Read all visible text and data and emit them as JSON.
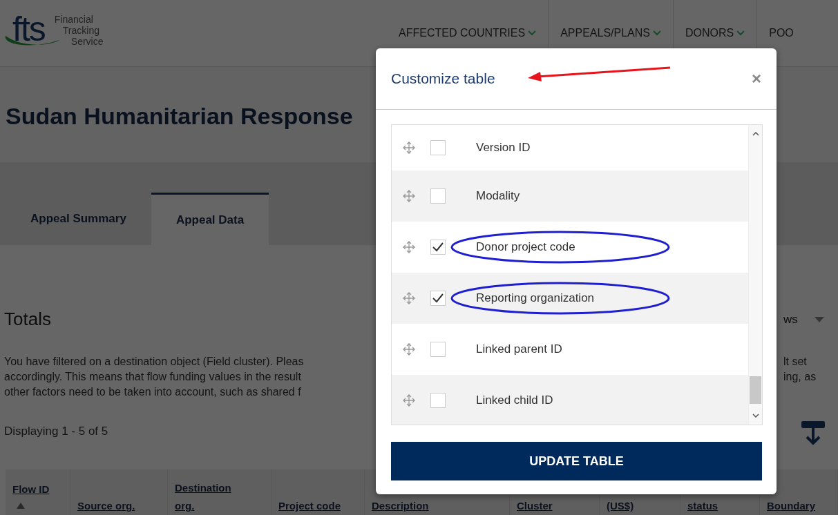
{
  "header": {
    "logo": {
      "mark": "fts",
      "lines": [
        "Financial",
        "Tracking",
        "Service"
      ]
    },
    "nav": [
      {
        "label": "AFFECTED COUNTRIES",
        "dropdown": true
      },
      {
        "label": "APPEALS/PLANS",
        "dropdown": true
      },
      {
        "label": "DONORS",
        "dropdown": true
      },
      {
        "label": "POO",
        "dropdown": false
      }
    ]
  },
  "page_title": "Sudan Humanitarian Response",
  "tabs": [
    {
      "label": "Appeal Summary",
      "selected": false
    },
    {
      "label": "Appeal Data",
      "selected": true
    }
  ],
  "totals": {
    "heading": "Totals",
    "rows_control": "ws",
    "paragraph_lines": [
      "You have filtered on a destination object (Field cluster). Pleas",
      "accordingly. This means that flow funding values in the result",
      "other factors need to be taken into account, such as shared f"
    ],
    "right_fragments": [
      "lt set",
      "ing, as"
    ],
    "displaying": "Displaying 1 - 5 of 5"
  },
  "table": {
    "columns": [
      {
        "label": "Flow ID",
        "sorted": true
      },
      {
        "label": "Source org.",
        "sorted": false
      },
      {
        "label": "Destination org.",
        "sorted": false
      },
      {
        "label": "Project code",
        "sorted": false
      },
      {
        "label": "Description",
        "sorted": false
      },
      {
        "label": "Cluster",
        "sorted": false
      },
      {
        "label": "(US$)",
        "sorted": false
      },
      {
        "label": "status",
        "sorted": false
      },
      {
        "label": "Boundary",
        "sorted": false
      }
    ]
  },
  "modal": {
    "title": "Customize table",
    "close": "×",
    "title_annotation": {
      "kind": "arrow",
      "color": "#e8141b"
    },
    "items": [
      {
        "label": "Version ID",
        "checked": false
      },
      {
        "label": "Modality",
        "checked": false
      },
      {
        "label": "Donor project code",
        "checked": true,
        "annotation": {
          "kind": "ellipse",
          "color": "#1f1fd0"
        }
      },
      {
        "label": "Reporting organization",
        "checked": true,
        "annotation": {
          "kind": "ellipse",
          "color": "#1f1fd0"
        }
      },
      {
        "label": "Linked parent ID",
        "checked": false
      },
      {
        "label": "Linked child ID",
        "checked": false
      }
    ],
    "button": "UPDATE TABLE"
  }
}
